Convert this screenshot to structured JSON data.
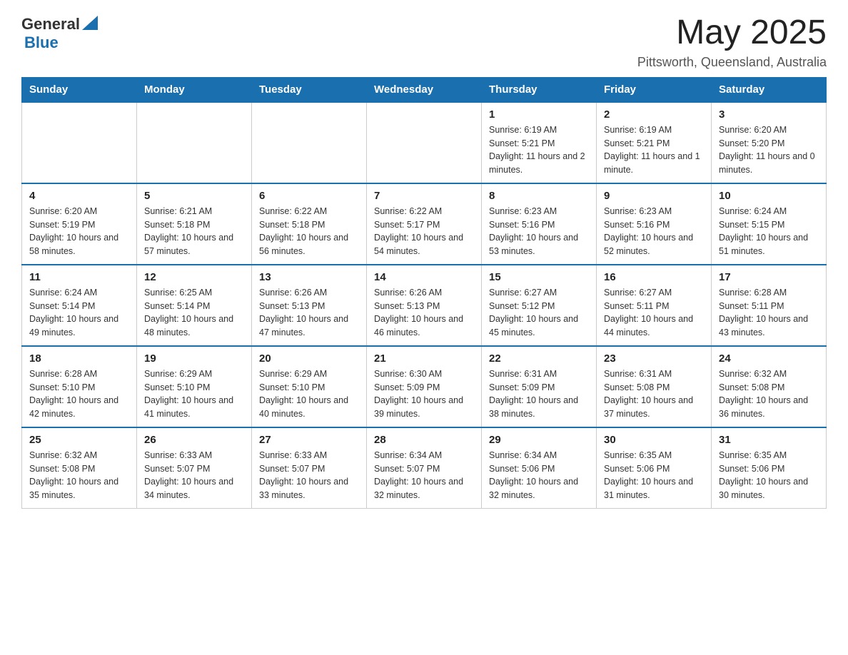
{
  "header": {
    "logo": {
      "general": "General",
      "blue": "Blue"
    },
    "title": "May 2025",
    "location": "Pittsworth, Queensland, Australia"
  },
  "days_of_week": [
    "Sunday",
    "Monday",
    "Tuesday",
    "Wednesday",
    "Thursday",
    "Friday",
    "Saturday"
  ],
  "weeks": [
    [
      {
        "day": "",
        "info": ""
      },
      {
        "day": "",
        "info": ""
      },
      {
        "day": "",
        "info": ""
      },
      {
        "day": "",
        "info": ""
      },
      {
        "day": "1",
        "info": "Sunrise: 6:19 AM\nSunset: 5:21 PM\nDaylight: 11 hours and 2 minutes."
      },
      {
        "day": "2",
        "info": "Sunrise: 6:19 AM\nSunset: 5:21 PM\nDaylight: 11 hours and 1 minute."
      },
      {
        "day": "3",
        "info": "Sunrise: 6:20 AM\nSunset: 5:20 PM\nDaylight: 11 hours and 0 minutes."
      }
    ],
    [
      {
        "day": "4",
        "info": "Sunrise: 6:20 AM\nSunset: 5:19 PM\nDaylight: 10 hours and 58 minutes."
      },
      {
        "day": "5",
        "info": "Sunrise: 6:21 AM\nSunset: 5:18 PM\nDaylight: 10 hours and 57 minutes."
      },
      {
        "day": "6",
        "info": "Sunrise: 6:22 AM\nSunset: 5:18 PM\nDaylight: 10 hours and 56 minutes."
      },
      {
        "day": "7",
        "info": "Sunrise: 6:22 AM\nSunset: 5:17 PM\nDaylight: 10 hours and 54 minutes."
      },
      {
        "day": "8",
        "info": "Sunrise: 6:23 AM\nSunset: 5:16 PM\nDaylight: 10 hours and 53 minutes."
      },
      {
        "day": "9",
        "info": "Sunrise: 6:23 AM\nSunset: 5:16 PM\nDaylight: 10 hours and 52 minutes."
      },
      {
        "day": "10",
        "info": "Sunrise: 6:24 AM\nSunset: 5:15 PM\nDaylight: 10 hours and 51 minutes."
      }
    ],
    [
      {
        "day": "11",
        "info": "Sunrise: 6:24 AM\nSunset: 5:14 PM\nDaylight: 10 hours and 49 minutes."
      },
      {
        "day": "12",
        "info": "Sunrise: 6:25 AM\nSunset: 5:14 PM\nDaylight: 10 hours and 48 minutes."
      },
      {
        "day": "13",
        "info": "Sunrise: 6:26 AM\nSunset: 5:13 PM\nDaylight: 10 hours and 47 minutes."
      },
      {
        "day": "14",
        "info": "Sunrise: 6:26 AM\nSunset: 5:13 PM\nDaylight: 10 hours and 46 minutes."
      },
      {
        "day": "15",
        "info": "Sunrise: 6:27 AM\nSunset: 5:12 PM\nDaylight: 10 hours and 45 minutes."
      },
      {
        "day": "16",
        "info": "Sunrise: 6:27 AM\nSunset: 5:11 PM\nDaylight: 10 hours and 44 minutes."
      },
      {
        "day": "17",
        "info": "Sunrise: 6:28 AM\nSunset: 5:11 PM\nDaylight: 10 hours and 43 minutes."
      }
    ],
    [
      {
        "day": "18",
        "info": "Sunrise: 6:28 AM\nSunset: 5:10 PM\nDaylight: 10 hours and 42 minutes."
      },
      {
        "day": "19",
        "info": "Sunrise: 6:29 AM\nSunset: 5:10 PM\nDaylight: 10 hours and 41 minutes."
      },
      {
        "day": "20",
        "info": "Sunrise: 6:29 AM\nSunset: 5:10 PM\nDaylight: 10 hours and 40 minutes."
      },
      {
        "day": "21",
        "info": "Sunrise: 6:30 AM\nSunset: 5:09 PM\nDaylight: 10 hours and 39 minutes."
      },
      {
        "day": "22",
        "info": "Sunrise: 6:31 AM\nSunset: 5:09 PM\nDaylight: 10 hours and 38 minutes."
      },
      {
        "day": "23",
        "info": "Sunrise: 6:31 AM\nSunset: 5:08 PM\nDaylight: 10 hours and 37 minutes."
      },
      {
        "day": "24",
        "info": "Sunrise: 6:32 AM\nSunset: 5:08 PM\nDaylight: 10 hours and 36 minutes."
      }
    ],
    [
      {
        "day": "25",
        "info": "Sunrise: 6:32 AM\nSunset: 5:08 PM\nDaylight: 10 hours and 35 minutes."
      },
      {
        "day": "26",
        "info": "Sunrise: 6:33 AM\nSunset: 5:07 PM\nDaylight: 10 hours and 34 minutes."
      },
      {
        "day": "27",
        "info": "Sunrise: 6:33 AM\nSunset: 5:07 PM\nDaylight: 10 hours and 33 minutes."
      },
      {
        "day": "28",
        "info": "Sunrise: 6:34 AM\nSunset: 5:07 PM\nDaylight: 10 hours and 32 minutes."
      },
      {
        "day": "29",
        "info": "Sunrise: 6:34 AM\nSunset: 5:06 PM\nDaylight: 10 hours and 32 minutes."
      },
      {
        "day": "30",
        "info": "Sunrise: 6:35 AM\nSunset: 5:06 PM\nDaylight: 10 hours and 31 minutes."
      },
      {
        "day": "31",
        "info": "Sunrise: 6:35 AM\nSunset: 5:06 PM\nDaylight: 10 hours and 30 minutes."
      }
    ]
  ]
}
